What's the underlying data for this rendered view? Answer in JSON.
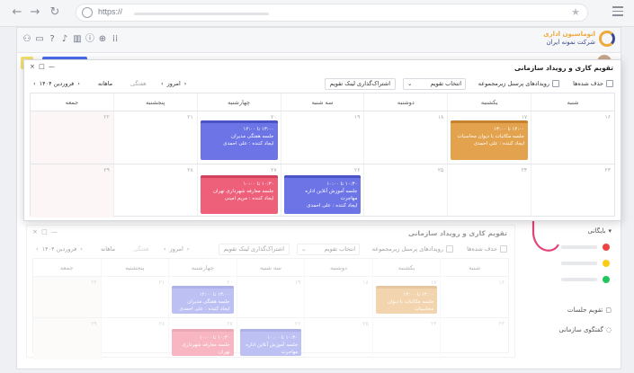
{
  "browser": {
    "url": "https://"
  },
  "app": {
    "logo_line1": "اتوماسیون اداری",
    "logo_line2": "شرکت نمونه ایران"
  },
  "sidebar": {
    "items": [
      {
        "label": "بایگانی",
        "icon": "chevron-down-icon"
      },
      {
        "label": "تقویم جلسات",
        "icon": "calendar-icon"
      },
      {
        "label": "گفتگوی سازمانی",
        "icon": "chat-icon"
      }
    ],
    "dot_colors": [
      "#ef4444",
      "#facc15",
      "#22c55e"
    ]
  },
  "calendar": {
    "title": "تقویم کاری و رویداد سازمانی",
    "window_controls": "× □ —",
    "toolbar": {
      "delete_label": "حذف شده‌ها",
      "staff_events_label": "رویدادهای پرسنل زیرمجموعه",
      "select_calendar": "انتخاب تقویم",
      "share_link": "اشتراک‌گذاری لینک تقویم",
      "today": "امروز",
      "weekly": "هفتگی",
      "monthly": "ماهانه",
      "month_label": "فروردین ۱۴۰۴"
    },
    "weekdays": [
      "شنبه",
      "یکشنبه",
      "دوشنبه",
      "سه شنبه",
      "چهارشنبه",
      "پنجشنبه",
      "جمعه"
    ],
    "weeks": [
      [
        "۱۶",
        "۱۷",
        "۱۸",
        "۱۹",
        "۲۰",
        "۲۱",
        "۲۲"
      ],
      [
        "۲۳",
        "۲۴",
        "۲۵",
        "۲۶",
        "۲۷",
        "۲۸",
        "۲۹"
      ]
    ],
    "events": [
      {
        "time": "۱۴:۰۰ تا ۱۳:۰۰",
        "title": "جلسه مکاتبات با دیوان محاسبات",
        "creator": "ایجاد کننده : علی احمدی",
        "color": "orange",
        "week": 0,
        "day": 1
      },
      {
        "time": "۱۳:۰۰ تا ۱۲:۰۰",
        "title": "جلسه هفتگی مدیران",
        "creator": "ایجاد کننده : علی احمدی",
        "color": "blue",
        "week": 0,
        "day": 4
      },
      {
        "time": "۱۰:۳۰ تا ۱۰:۰۰",
        "title": "جلسه آموزش آنلاین اداره مهاجرت",
        "creator": "ایجاد کننده : علی احمدی",
        "color": "blue",
        "week": 1,
        "day": 3
      },
      {
        "time": "۱۰:۳۰ تا ۱۰:۰۰",
        "title": "جلسه معارفه شهرداری تهران",
        "creator": "ایجاد کننده : مریم امینی",
        "color": "red",
        "week": 1,
        "day": 4
      }
    ]
  }
}
